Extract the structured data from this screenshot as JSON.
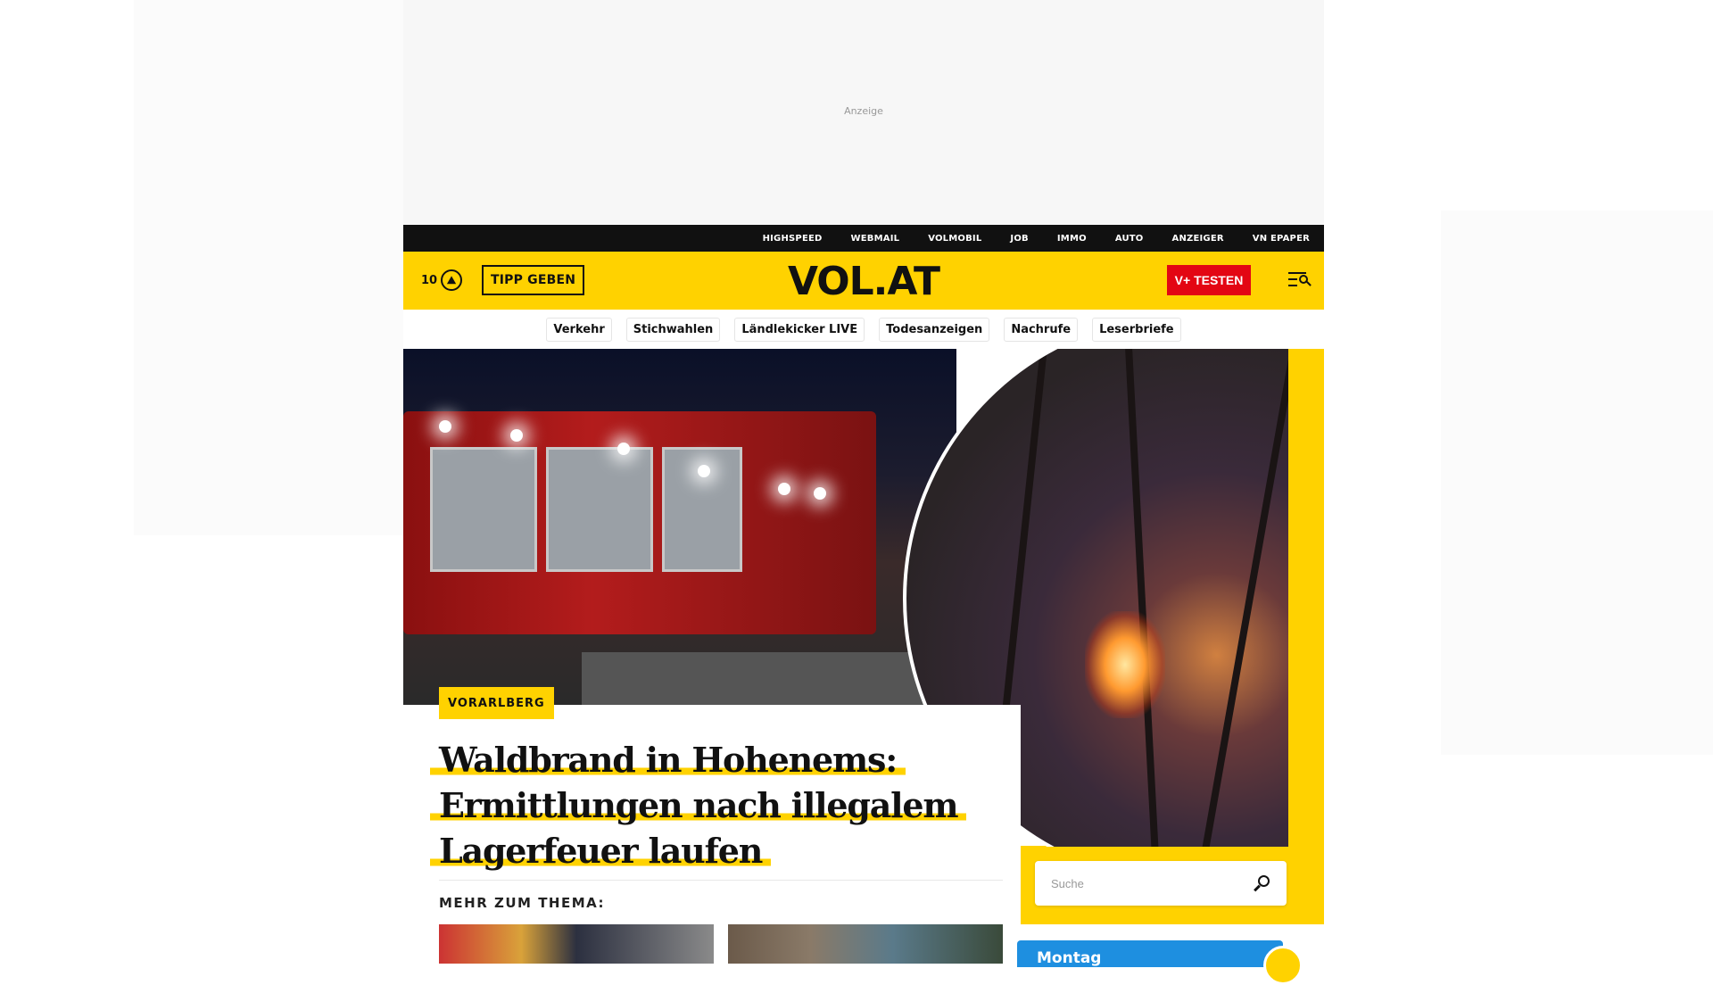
{
  "ad": {
    "label": "Anzeige"
  },
  "topbar": {
    "links": [
      "HIGHSPEED",
      "WEBMAIL",
      "VOLMOBIL",
      "JOB",
      "IMMO",
      "AUTO",
      "ANZEIGER",
      "VN EPAPER"
    ]
  },
  "header": {
    "temperature": "10",
    "tipp_label": "TIPP GEBEN",
    "logo": "VOL.AT",
    "vplus_label": "V+ TESTEN"
  },
  "subnav": {
    "items": [
      "Verkehr",
      "Stichwahlen",
      "Ländlekicker LIVE",
      "Todesanzeigen",
      "Nachrufe",
      "Leserbriefe"
    ]
  },
  "article": {
    "kicker": "VORARLBERG",
    "headline_lines": [
      "Waldbrand in Hohenems:",
      "Ermittlungen nach illegalem",
      "Lagerfeuer laufen"
    ],
    "more_label": "MEHR ZUM THEMA:"
  },
  "search": {
    "placeholder": "Suche"
  },
  "weather_card": {
    "day": "Montag"
  },
  "colors": {
    "brand_yellow": "#ffd200",
    "accent_red": "#e30613",
    "weather_blue": "#1e8fe0"
  }
}
